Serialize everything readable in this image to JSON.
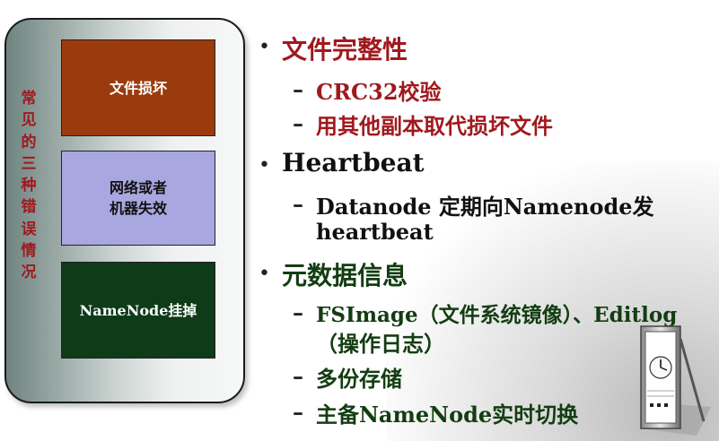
{
  "left_panel": {
    "vertical_title": "常见的三种错误情况",
    "box1": "文件损坏",
    "box2": "网络或者\n机器失效",
    "box3": "NameNode挂掉"
  },
  "bullets": {
    "b1": {
      "title": "文件完整性",
      "sub1": "CRC32校验",
      "sub2": "用其他副本取代损坏文件"
    },
    "b2": {
      "title": "Heartbeat",
      "sub1a": "Datanode 定期向Namenode发",
      "sub1b": "heartbeat"
    },
    "b3": {
      "title": "元数据信息",
      "sub1a": "FSImage（文件系统镜像）、Editlog",
      "sub1b": "（操作日志）",
      "sub2": "多份存储",
      "sub3": "主备NameNode实时切换"
    },
    "bullet_glyph": "•",
    "dash_glyph": "–"
  },
  "colors": {
    "red": "#a0191e",
    "green": "#123d12",
    "brown_box": "#9b3b0d",
    "lavender_box": "#a9a7e0",
    "dark_green_box": "#0e3b18"
  },
  "decoration": {
    "icon": "clock-icon"
  }
}
